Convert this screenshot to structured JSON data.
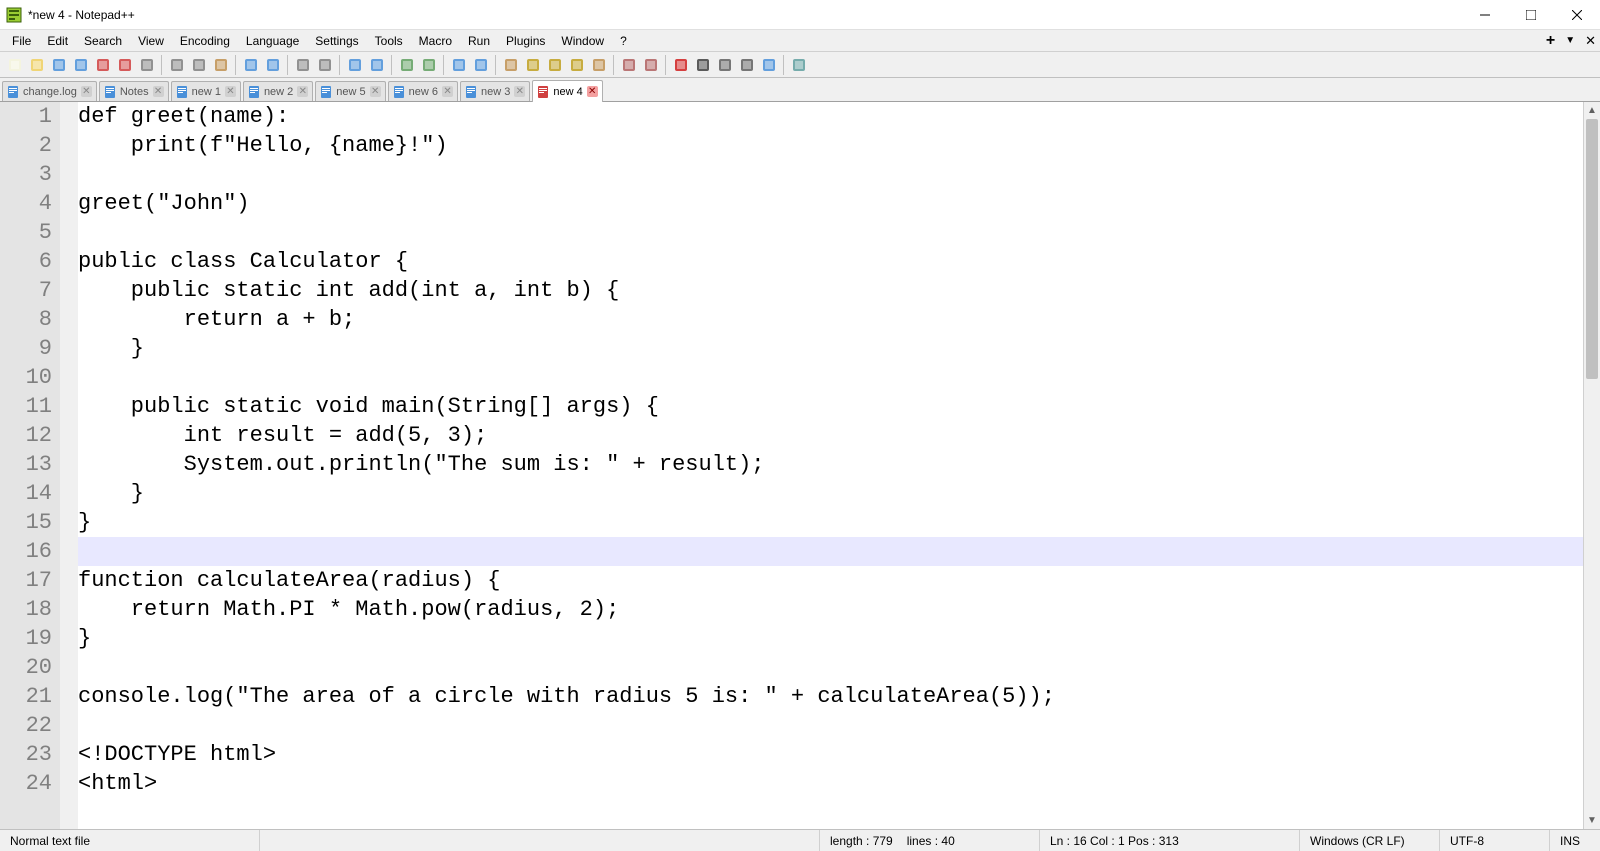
{
  "window": {
    "title": "*new 4 - Notepad++"
  },
  "menu": {
    "items": [
      "File",
      "Edit",
      "Search",
      "View",
      "Encoding",
      "Language",
      "Settings",
      "Tools",
      "Macro",
      "Run",
      "Plugins",
      "Window",
      "?"
    ]
  },
  "toolbar": {
    "buttons": [
      {
        "name": "new-file-icon",
        "color": "#f5f5dc"
      },
      {
        "name": "open-file-icon",
        "color": "#f0d060"
      },
      {
        "name": "save-icon",
        "color": "#4a90d9"
      },
      {
        "name": "save-all-icon",
        "color": "#4a90d9"
      },
      {
        "name": "close-icon",
        "color": "#d04040"
      },
      {
        "name": "close-all-icon",
        "color": "#d04040"
      },
      {
        "name": "print-icon",
        "color": "#808080"
      },
      {
        "sep": true
      },
      {
        "name": "cut-icon",
        "color": "#808080"
      },
      {
        "name": "copy-icon",
        "color": "#808080"
      },
      {
        "name": "paste-icon",
        "color": "#c09050"
      },
      {
        "sep": true
      },
      {
        "name": "undo-icon",
        "color": "#4a90d9"
      },
      {
        "name": "redo-icon",
        "color": "#4a90d9"
      },
      {
        "sep": true
      },
      {
        "name": "find-icon",
        "color": "#808080"
      },
      {
        "name": "replace-icon",
        "color": "#808080"
      },
      {
        "sep": true
      },
      {
        "name": "zoom-in-icon",
        "color": "#4a90d9"
      },
      {
        "name": "zoom-out-icon",
        "color": "#4a90d9"
      },
      {
        "sep": true
      },
      {
        "name": "sync-v-icon",
        "color": "#60a060"
      },
      {
        "name": "sync-h-icon",
        "color": "#60a060"
      },
      {
        "sep": true
      },
      {
        "name": "wordwrap-icon",
        "color": "#4a90d9"
      },
      {
        "name": "allchars-icon",
        "color": "#4a90d9"
      },
      {
        "sep": true
      },
      {
        "name": "indent-guide-icon",
        "color": "#c09050"
      },
      {
        "name": "lang-icon",
        "color": "#c0a020"
      },
      {
        "name": "doc-map-icon",
        "color": "#c0a020"
      },
      {
        "name": "doc-list-icon",
        "color": "#c0a020"
      },
      {
        "name": "func-list-icon",
        "color": "#c09050"
      },
      {
        "sep": true
      },
      {
        "name": "folder-workspace-icon",
        "color": "#b06060"
      },
      {
        "name": "monitor-icon",
        "color": "#b06060"
      },
      {
        "sep": true
      },
      {
        "name": "record-icon",
        "color": "#d02020"
      },
      {
        "name": "stop-icon",
        "color": "#404040"
      },
      {
        "name": "play-icon",
        "color": "#606060"
      },
      {
        "name": "play-multi-icon",
        "color": "#606060"
      },
      {
        "name": "save-macro-icon",
        "color": "#4a90d9"
      },
      {
        "sep": true
      },
      {
        "name": "spellcheck-icon",
        "color": "#60a0a0"
      }
    ]
  },
  "tabs": [
    {
      "label": "change.log",
      "active": false,
      "dirty": false
    },
    {
      "label": "Notes",
      "active": false,
      "dirty": false
    },
    {
      "label": "new 1",
      "active": false,
      "dirty": false
    },
    {
      "label": "new 2",
      "active": false,
      "dirty": false
    },
    {
      "label": "new 5",
      "active": false,
      "dirty": false
    },
    {
      "label": "new 6",
      "active": false,
      "dirty": false
    },
    {
      "label": "new 3",
      "active": false,
      "dirty": false
    },
    {
      "label": "new 4",
      "active": true,
      "dirty": true
    }
  ],
  "editor": {
    "current_line_index": 15,
    "lines": [
      "def greet(name):",
      "    print(f\"Hello, {name}!\")",
      "",
      "greet(\"John\")",
      "",
      "public class Calculator {",
      "    public static int add(int a, int b) {",
      "        return a + b;",
      "    }",
      "",
      "    public static void main(String[] args) {",
      "        int result = add(5, 3);",
      "        System.out.println(\"The sum is: \" + result);",
      "    }",
      "}",
      "",
      "function calculateArea(radius) {",
      "    return Math.PI * Math.pow(radius, 2);",
      "}",
      "",
      "console.log(\"The area of a circle with radius 5 is: \" + calculateArea(5));",
      "",
      "<!DOCTYPE html>",
      "<html>"
    ]
  },
  "status": {
    "doc_type": "Normal text file",
    "length_label": "length : 779",
    "lines_label": "lines : 40",
    "position_label": "Ln : 16   Col : 1   Pos : 313",
    "eol": "Windows (CR LF)",
    "encoding": "UTF-8",
    "mode": "INS"
  }
}
